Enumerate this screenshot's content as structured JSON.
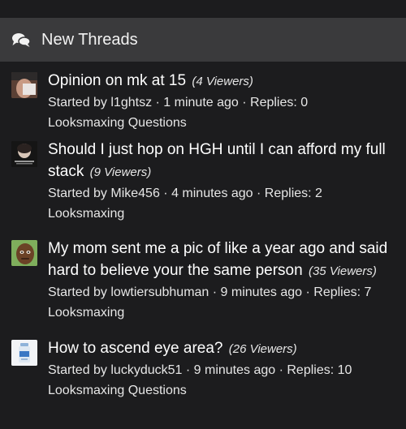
{
  "section": {
    "title": "New Threads",
    "icon": "comments-icon"
  },
  "threads": [
    {
      "title": "Opinion on mk at 15",
      "viewers": "(4 Viewers)",
      "meta": "Started by l1ghtsz · 1 minute ago · Replies: 0",
      "forum": "Looksmaxing Questions"
    },
    {
      "title": "Should I just hop on HGH until I can afford my full stack",
      "viewers": "(9 Viewers)",
      "meta": "Started by Mike456 · 4 minutes ago · Replies: 2",
      "forum": "Looksmaxing"
    },
    {
      "title": "My mom sent me a pic of like a year ago and said hard to believe your the same person",
      "viewers": "(35 Viewers)",
      "meta": "Started by lowtiersubhuman · 9 minutes ago · Replies: 7",
      "forum": "Looksmaxing"
    },
    {
      "title": "How to ascend eye area?",
      "viewers": "(26 Viewers)",
      "meta": "Started by luckyduck51 · 9 minutes ago · Replies: 10",
      "forum": "Looksmaxing Questions"
    }
  ]
}
